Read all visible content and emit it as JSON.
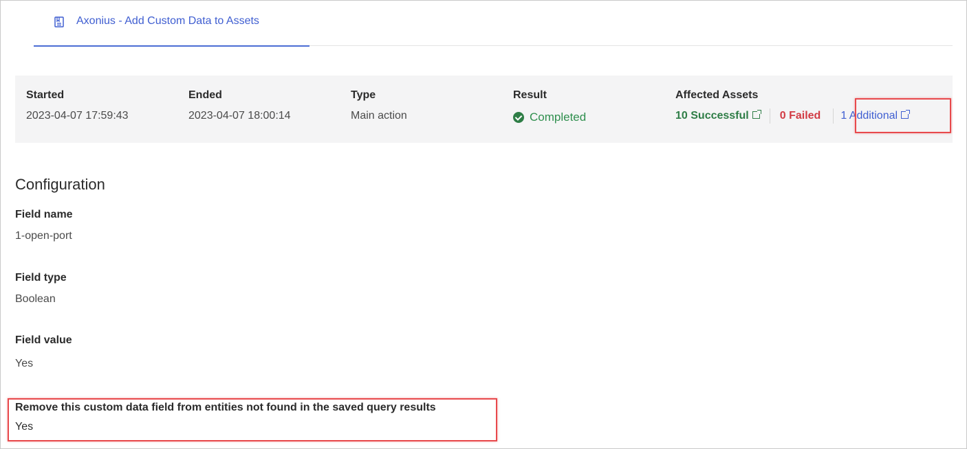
{
  "tab": {
    "icon": "bookmark-document-icon",
    "label": "Axonius - Add Custom Data to Assets"
  },
  "summary": {
    "started": {
      "label": "Started",
      "value": "2023-04-07 17:59:43"
    },
    "ended": {
      "label": "Ended",
      "value": "2023-04-07 18:00:14"
    },
    "type": {
      "label": "Type",
      "value": "Main action"
    },
    "result": {
      "label": "Result",
      "value": "Completed",
      "icon": "check-circle-icon",
      "color": "#2e7d46"
    },
    "affected_assets": {
      "label": "Affected Assets",
      "successful": "10 Successful",
      "failed": "0 Failed",
      "additional": "1 Additional"
    }
  },
  "configuration": {
    "title": "Configuration",
    "fields": [
      {
        "label": "Field name",
        "value": "1-open-port"
      },
      {
        "label": "Field type",
        "value": "Boolean"
      },
      {
        "label": "Field value",
        "value": "Yes"
      },
      {
        "label": "Remove this custom data field from entities not found in the saved query results",
        "value": "Yes"
      }
    ]
  },
  "colors": {
    "accent": "#3f5ed1",
    "success": "#2e7d46",
    "failure": "#d23b44",
    "highlight": "#e8494c"
  }
}
